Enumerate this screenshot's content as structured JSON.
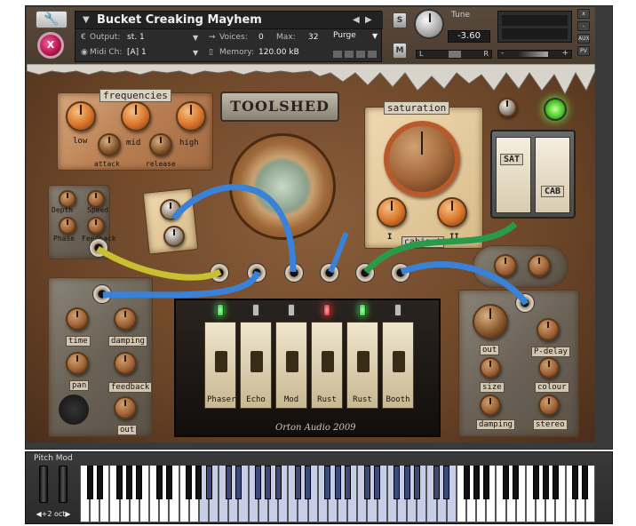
{
  "header": {
    "instrument_title": "Bucket Creaking Mayhem",
    "output_label": "Output:",
    "output_value": "st. 1",
    "voices_label": "Voices:",
    "voices_value": "0",
    "max_label": "Max:",
    "max_value": "32",
    "purge_label": "Purge",
    "midi_label": "Midi Ch:",
    "midi_value": "[A]  1",
    "memory_label": "Memory:",
    "memory_value": "120.00 kB",
    "solo_label": "S",
    "mute_label": "M",
    "tune_label": "Tune",
    "tune_value": "-3.60",
    "pan_left": "L",
    "pan_right": "R",
    "vol_minus": "-",
    "vol_plus": "+",
    "side_buttons": [
      "x",
      "-",
      "AUX",
      "PV"
    ],
    "close_label": "X"
  },
  "panel": {
    "logo": "TOOLSHED",
    "frequencies": {
      "title": "frequencies",
      "labels": [
        "low",
        "mid",
        "high",
        "attack",
        "release"
      ]
    },
    "phaser_plate": {
      "labels": [
        "Depth",
        "Speed",
        "Phase",
        "Feedback"
      ]
    },
    "saturation": {
      "title": "saturation",
      "cabinet_label": "cabinet",
      "marks": [
        "I",
        "II"
      ]
    },
    "cabinet_switches": {
      "left": "SAT",
      "right": "CAB"
    },
    "delay_plate": {
      "labels": [
        "time",
        "damping",
        "pan",
        "feedback",
        "out"
      ]
    },
    "reverb_plate": {
      "labels": [
        "out",
        "P-delay",
        "size",
        "colour",
        "damping",
        "stereo"
      ]
    },
    "fx_switches": [
      {
        "label": "Phaser",
        "led": "green"
      },
      {
        "label": "Echo",
        "led": "off"
      },
      {
        "label": "Mod",
        "led": "off"
      },
      {
        "label": "Rust",
        "led": "red"
      },
      {
        "label": "Rust",
        "led": "green"
      },
      {
        "label": "Booth",
        "led": "off"
      }
    ],
    "signature": "Orton Audio 2009"
  },
  "keyboard": {
    "pitch_label": "Pitch Mod",
    "octave_label": "+2 oct"
  },
  "colors": {
    "panel_wood": "#6b4528",
    "knob_orange": "#d8742a",
    "led_green": "#33ff44",
    "led_red": "#ff3333",
    "key_highlight": "#c6cee8"
  }
}
